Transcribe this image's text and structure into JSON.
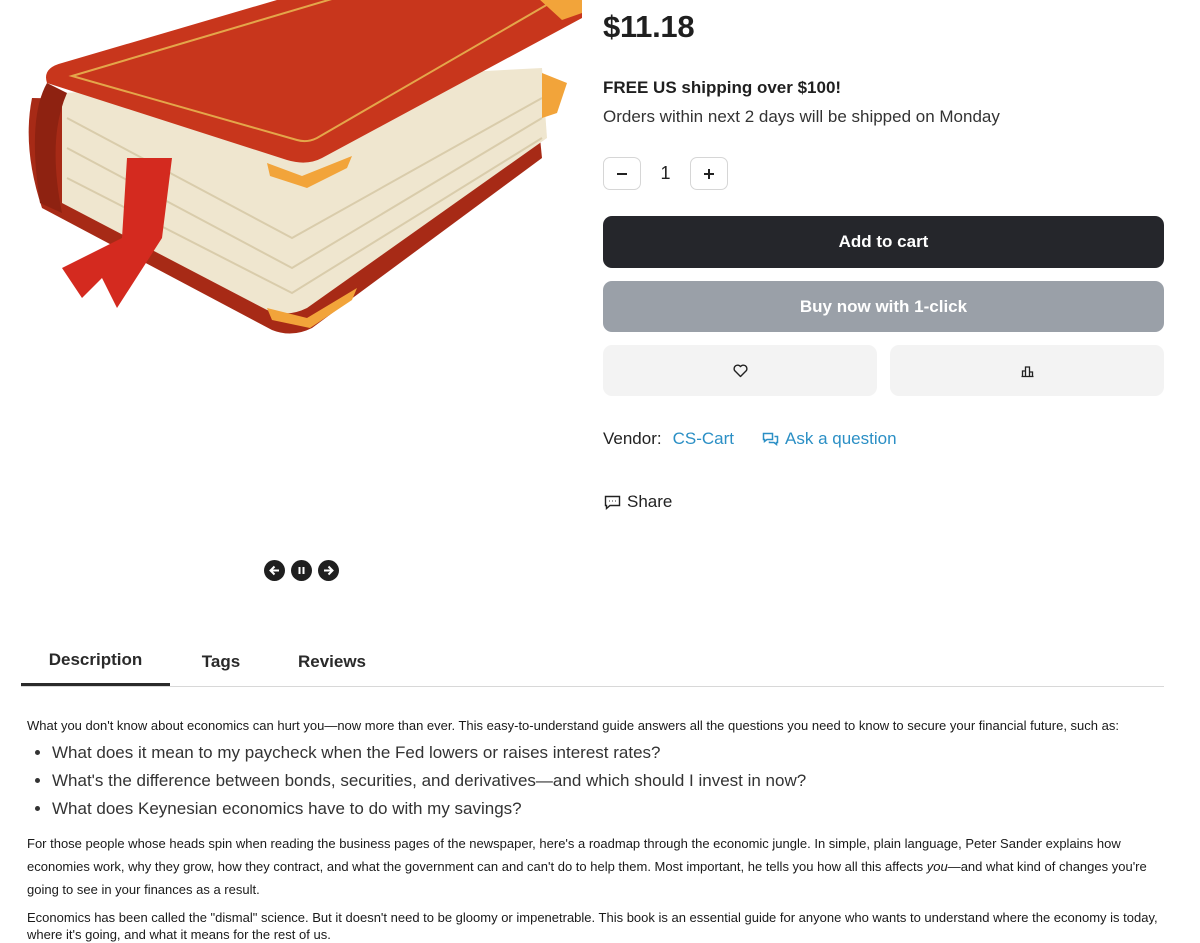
{
  "product": {
    "price": "$11.18",
    "shipping_title": "FREE US shipping over $100!",
    "shipping_note": "Orders within next 2 days will be shipped on Monday",
    "quantity": "1",
    "add_to_cart": "Add to cart",
    "buy_now": "Buy now with 1-click"
  },
  "vendor": {
    "label": "Vendor:",
    "name": "CS-Cart",
    "ask": "Ask a question"
  },
  "share_label": "Share",
  "tabs": [
    {
      "label": "Description",
      "active": true
    },
    {
      "label": "Tags",
      "active": false
    },
    {
      "label": "Reviews",
      "active": false
    }
  ],
  "description": {
    "intro": "What you don't know about economics can hurt you—now more than ever. This easy-to-understand guide answers all the questions you need to know to secure your financial future, such as:",
    "bullets": [
      "What does it mean to my paycheck when the Fed lowers or raises interest rates?",
      "What's the difference between bonds, securities, and derivatives—and which should I invest in now?",
      "What does Keynesian economics have to do with my savings?"
    ],
    "p2_part1": "For those people whose heads spin when reading the business pages of the newspaper, here's a roadmap through the economic jungle. In simple, plain language, Peter Sander explains how economies work, why they grow, how they contract, and what the government can and can't do to help them. Most important, he tells you how all this affects ",
    "p2_emph": "you",
    "p2_part2": "—and what kind of changes you're going to see in your finances as a result.",
    "p3": "Economics has been called the \"dismal\" science. But it doesn't need to be gloomy or impenetrable. This book is an essential guide for anyone who wants to understand where the economy is today, where it's going, and what it means for the rest of us."
  },
  "colors": {
    "cart_button": "#25262b",
    "buy_button": "#9aa0a8",
    "link": "#2b8fc5"
  },
  "icons": [
    "minus-icon",
    "plus-icon",
    "heart-icon",
    "compare-icon",
    "chat-icon",
    "share-icon",
    "arrow-left-circle-icon",
    "pause-circle-icon",
    "arrow-right-circle-icon"
  ]
}
